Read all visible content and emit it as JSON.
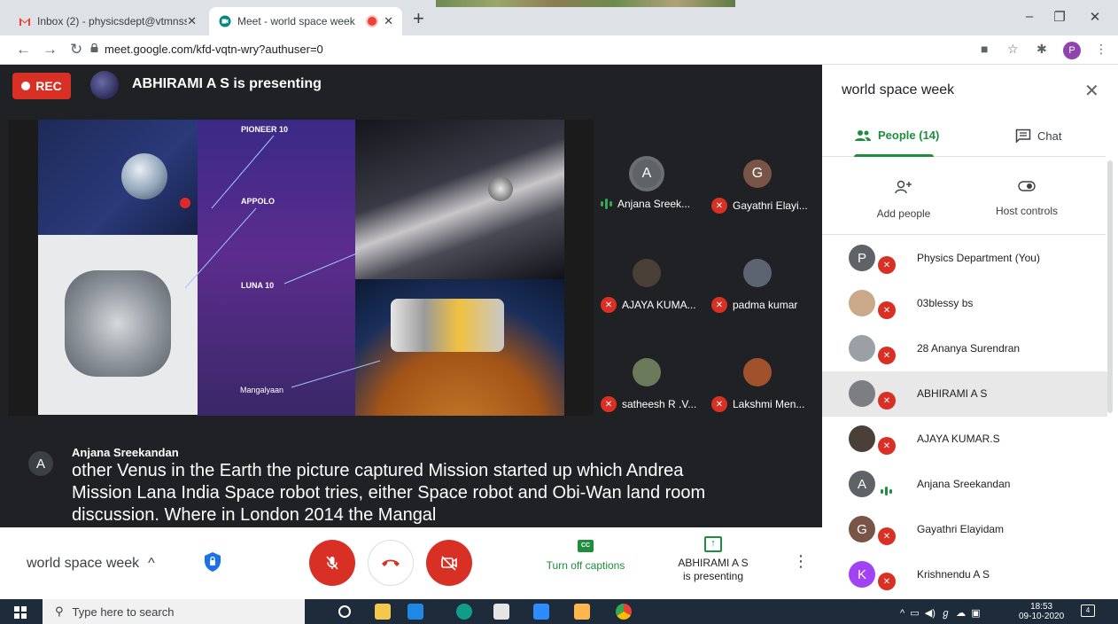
{
  "browser": {
    "tabs": [
      {
        "title": "Inbox (2) - physicsdept@vtmnssc",
        "close": "✕"
      },
      {
        "title": "Meet - world space week",
        "close": "✕"
      }
    ],
    "new_tab": "+",
    "window_controls": {
      "minimize": "–",
      "restore": "❐",
      "close": "✕"
    },
    "url": "meet.google.com/kfd-vqtn-wry?authuser=0",
    "profile_initial": "P"
  },
  "meet": {
    "rec_label": "REC",
    "presenting_banner": "ABHIRAMI A S is presenting",
    "slide_labels": {
      "pioneer": "PIONEER 10",
      "appolo": "APPOLO",
      "luna": "LUNA 10",
      "mangalyaan": "Mangalyaan"
    },
    "tiles": [
      {
        "initial": "A",
        "name": "Anjana Sreek...",
        "speaking": true,
        "color": "#5f6368"
      },
      {
        "initial": "G",
        "name": "Gayathri Elayi...",
        "speaking": false,
        "color": "#795548"
      },
      {
        "initial": "",
        "name": "AJAYA KUMA...",
        "speaking": false,
        "color": "#4a4037"
      },
      {
        "initial": "",
        "name": "padma kumar",
        "speaking": false,
        "color": "#5b6470"
      },
      {
        "initial": "",
        "name": "satheesh R .V...",
        "speaking": false,
        "color": "#6b7a5a"
      },
      {
        "initial": "",
        "name": "Lakshmi Men...",
        "speaking": false,
        "color": "#a0522d"
      }
    ],
    "caption": {
      "initial": "A",
      "speaker": "Anjana Sreekandan",
      "text": "other Venus in the Earth the picture captured Mission started up which Andrea Mission Lana India Space robot tries, either Space robot and Obi-Wan land room discussion. Where in London 2014 the Mangal"
    },
    "controls": {
      "meeting_name": "world space week",
      "expand_icon": "^",
      "captions_label": "Turn off captions",
      "cc_icon_text": "CC",
      "presenting_line1": "ABHIRAMI A S",
      "presenting_line2": "is presenting"
    }
  },
  "panel": {
    "title": "world space week",
    "tab_people": "People (14)",
    "tab_chat": "Chat",
    "add_people": "Add people",
    "host_controls": "Host controls",
    "people": [
      {
        "name": "Physics Department (You)",
        "initial": "P",
        "color": "#5f6368",
        "state": "muted"
      },
      {
        "name": "03blessy bs",
        "initial": "",
        "color": "#c9a98a",
        "state": "muted"
      },
      {
        "name": "28 Ananya Surendran",
        "initial": "",
        "color": "#9aa0a6",
        "state": "muted"
      },
      {
        "name": "ABHIRAMI A S",
        "initial": "",
        "color": "#7d7d84",
        "state": "muted"
      },
      {
        "name": "AJAYA KUMAR.S",
        "initial": "",
        "color": "#4a4037",
        "state": "muted"
      },
      {
        "name": "Anjana Sreekandan",
        "initial": "A",
        "color": "#5f6368",
        "state": "speaking"
      },
      {
        "name": "Gayathri Elayidam",
        "initial": "G",
        "color": "#795548",
        "state": "muted"
      },
      {
        "name": "Krishnendu A S",
        "initial": "K",
        "color": "#a142f4",
        "state": "muted"
      }
    ]
  },
  "taskbar": {
    "search_placeholder": "Type here to search",
    "time": "18:53",
    "date": "09-10-2020",
    "notifications": "4"
  }
}
